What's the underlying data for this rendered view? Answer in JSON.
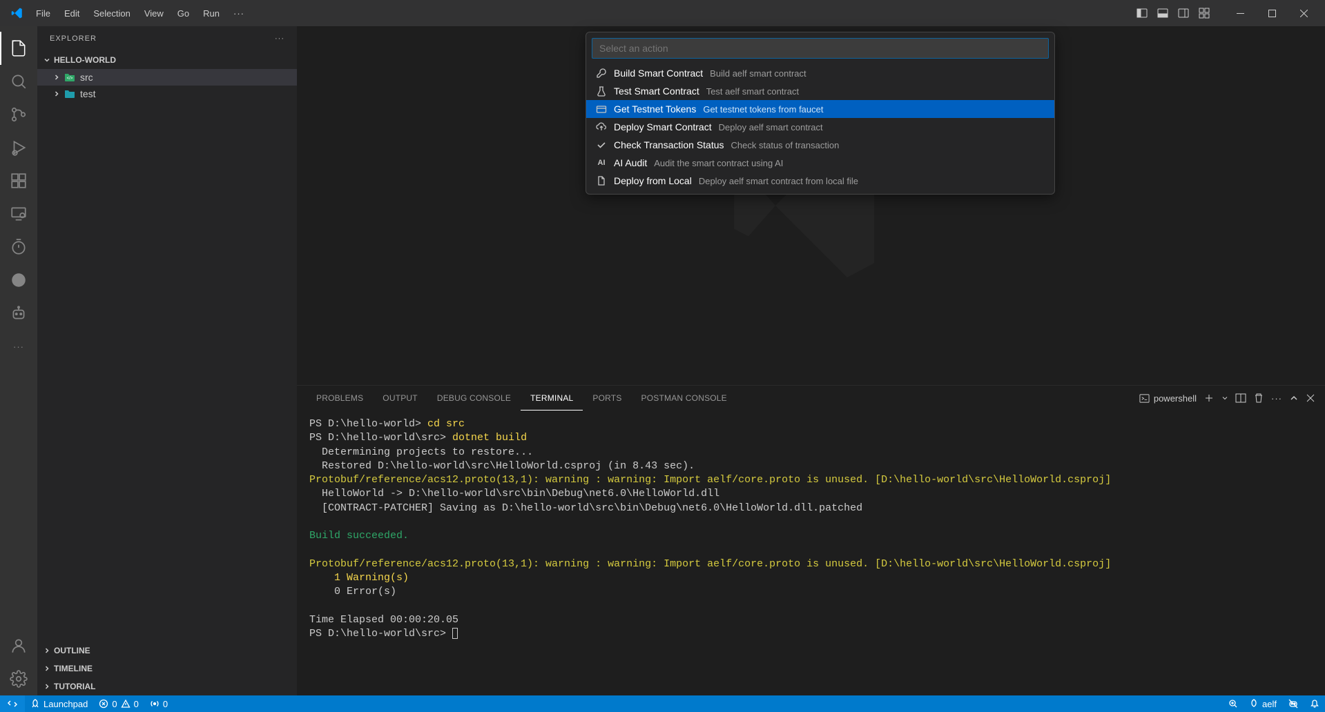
{
  "menubar": {
    "file": "File",
    "edit": "Edit",
    "selection": "Selection",
    "view": "View",
    "go": "Go",
    "run": "Run"
  },
  "sidebar": {
    "title": "EXPLORER",
    "workspace": "HELLO-WORLD",
    "tree": [
      {
        "label": "src"
      },
      {
        "label": "test"
      }
    ],
    "sections": {
      "outline": "OUTLINE",
      "timeline": "TIMELINE",
      "tutorial": "TUTORIAL"
    }
  },
  "commandPalette": {
    "placeholder": "Select an action",
    "items": [
      {
        "label": "Build Smart Contract",
        "desc": "Build aelf smart contract",
        "icon": "wrench"
      },
      {
        "label": "Test Smart Contract",
        "desc": "Test aelf smart contract",
        "icon": "beaker"
      },
      {
        "label": "Get Testnet Tokens",
        "desc": "Get testnet tokens from faucet",
        "icon": "card",
        "selected": true
      },
      {
        "label": "Deploy Smart Contract",
        "desc": "Deploy aelf smart contract",
        "icon": "cloud-up"
      },
      {
        "label": "Check Transaction Status",
        "desc": "Check status of transaction",
        "icon": "check"
      },
      {
        "label": "AI Audit",
        "desc": "Audit the smart contract using AI",
        "icon": "ai"
      },
      {
        "label": "Deploy from Local",
        "desc": "Deploy aelf smart contract from local file",
        "icon": "file"
      }
    ]
  },
  "panel": {
    "tabs": {
      "problems": "PROBLEMS",
      "output": "OUTPUT",
      "debug": "DEBUG CONSOLE",
      "terminal": "TERMINAL",
      "ports": "PORTS",
      "postman": "POSTMAN CONSOLE"
    },
    "shell": "powershell",
    "terminal": {
      "l1a": "PS D:\\hello-world> ",
      "l1b": "cd src",
      "l2a": "PS D:\\hello-world\\src> ",
      "l2b": "dotnet build",
      "l3": "  Determining projects to restore...",
      "l4": "  Restored D:\\hello-world\\src\\HelloWorld.csproj (in 8.43 sec).",
      "l5": "Protobuf/reference/acs12.proto(13,1): warning : warning: Import aelf/core.proto is unused. [D:\\hello-world\\src\\HelloWorld.csproj]",
      "l6": "  HelloWorld -> D:\\hello-world\\src\\bin\\Debug\\net6.0\\HelloWorld.dll",
      "l7": "  [CONTRACT-PATCHER] Saving as D:\\hello-world\\src\\bin\\Debug\\net6.0\\HelloWorld.dll.patched",
      "l9": "Build succeeded.",
      "l11": "Protobuf/reference/acs12.proto(13,1): warning : warning: Import aelf/core.proto is unused. [D:\\hello-world\\src\\HelloWorld.csproj]",
      "l12": "    1 Warning(s)",
      "l13": "    0 Error(s)",
      "l15": "Time Elapsed 00:00:20.05",
      "l16": "PS D:\\hello-world\\src> "
    }
  },
  "statusbar": {
    "launchpad": "Launchpad",
    "errors": "0",
    "warnings": "0",
    "ports": "0",
    "aelf": "aelf"
  }
}
